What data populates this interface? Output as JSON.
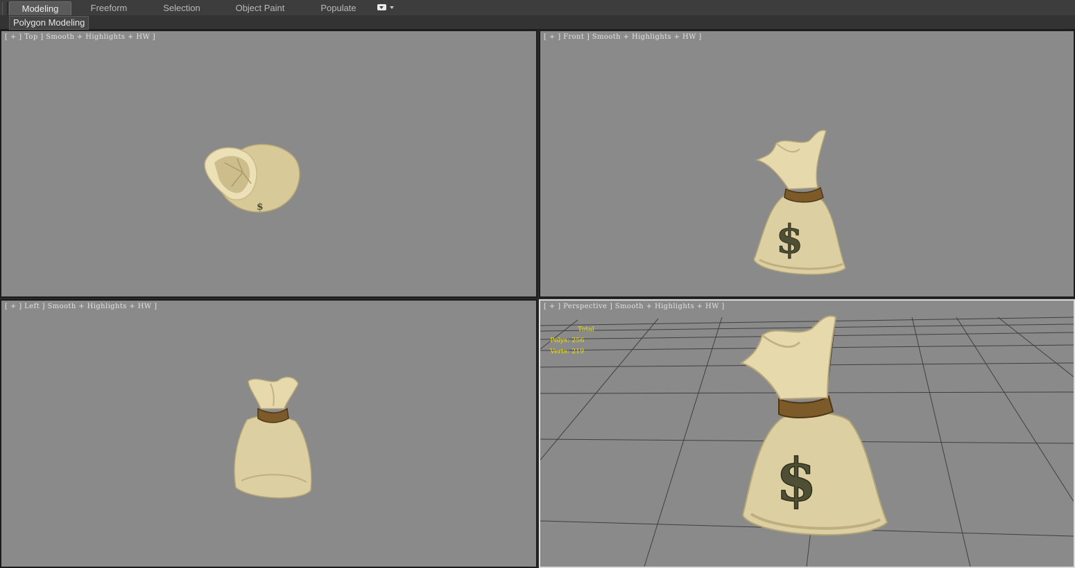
{
  "ribbon": {
    "tabs": [
      {
        "label": "Modeling",
        "active": true
      },
      {
        "label": "Freeform",
        "active": false
      },
      {
        "label": "Selection",
        "active": false
      },
      {
        "label": "Object Paint",
        "active": false
      },
      {
        "label": "Populate",
        "active": false
      }
    ],
    "options_icon": "dropdown-box-icon",
    "panel_title": "Polygon Modeling"
  },
  "viewports": {
    "top": {
      "label": "[ + ] Top ] Smooth + Highlights + HW ]"
    },
    "front": {
      "label": "[ + ] Front ] Smooth + Highlights + HW ]"
    },
    "left": {
      "label": "[ + ] Left ] Smooth + Highlights + HW ]"
    },
    "perspective": {
      "label": "[ + ] Perspective ] Smooth + Highlights + HW ]",
      "active": true
    }
  },
  "stats": {
    "header": "Total",
    "polys_label": "Polys:",
    "polys_value": "256",
    "verts_label": "Verts:",
    "verts_value": "219"
  },
  "colors": {
    "viewport_bg": "#8a8a8a",
    "bag_cloth": "#ded0a4",
    "rope": "#7d5a2a",
    "dollar": "#4f4f34",
    "stats_text": "#f0e000",
    "grid_line": "#3a3a3a"
  },
  "model": {
    "name_icon": "money-bag-icon",
    "symbol": "$"
  }
}
